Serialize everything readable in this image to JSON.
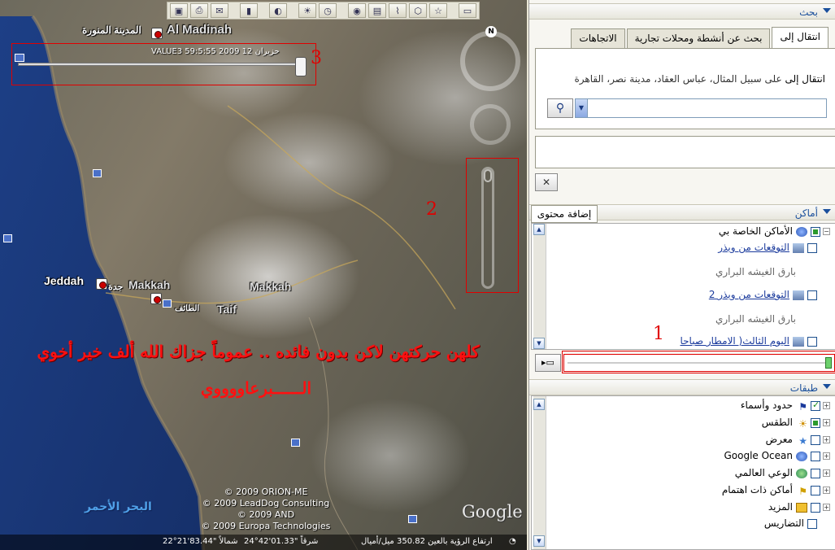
{
  "toolbar": {
    "icons": [
      "sidebar-icon",
      "placemark-icon",
      "polygon-icon",
      "path-icon",
      "image-overlay-icon",
      "record-tour-icon",
      "history-icon",
      "sun-icon",
      "planets-icon",
      "ruler-icon",
      "email-icon",
      "print-icon",
      "google-maps-icon"
    ]
  },
  "map": {
    "cities": {
      "madinah_ar": "المدينة المنورة",
      "madinah_en": "Al Madinah",
      "jeddah_en": "Jeddah",
      "jeddah_ar": "جدة",
      "makkah_en": "Makkah",
      "makkah_ar": "مكة",
      "makkah2": "Makkah",
      "taif_en": "Taif",
      "taif_ar": "الطائف"
    },
    "time_label": "VALUE3 59:5:55 2009 12 حزيران",
    "annotation_numbers": {
      "one": "1",
      "two": "2",
      "three": "3"
    },
    "note_line1": "كلهن حركتهن لاكن بدون فائده .. عموماً جزاك الله ألف خير أخوي",
    "note_line2": "الــــــبرعاووووي",
    "sea_label": "البحر الأحمر",
    "copyright": [
      "© 2009 ORION-ME",
      "© 2009 LeadDog Consulting",
      "© 2009 AND",
      "© 2009 Europa Technologies"
    ],
    "google_logo": "Google",
    "status": {
      "lat": "22°21'83.44\" شمالاً",
      "lon": "24°42'01.33\" شرقاً",
      "alt": "ارتفاع الرؤية بالعين 350.82 ميل/أميال",
      "compass_n": "N"
    }
  },
  "panel": {
    "search_header": "بحث",
    "tabs": [
      "انتقال إلى",
      "بحث عن أنشطة ومحلات تجارية",
      "الاتجاهات"
    ],
    "search_hint_bold": "انتقال إلى",
    "search_hint_rest": "على سبيل المثال، عباس العقاد، مدينة نصر، القاهرة",
    "search_value": "",
    "clear_label": "✕",
    "places_header": "أماكن",
    "add_content": "إضافة محتوى",
    "places_items": [
      {
        "label": "الأماكن الخاصة بي",
        "type": "folder"
      },
      {
        "label": "التوقعات من ويذر",
        "type": "link"
      },
      {
        "label": "بارق الغيشه البراري",
        "type": "plain"
      },
      {
        "label": "التوقعات من ويذر 2",
        "type": "link"
      },
      {
        "label": "بارق الغيشه البراري",
        "type": "plain"
      },
      {
        "label": "اليوم الثالث( الامطار صباحا",
        "type": "link"
      }
    ],
    "layers_header": "طبقات",
    "layers_items": [
      {
        "label": "حدود وأسماء",
        "checked": "on",
        "icon": "flag-icon"
      },
      {
        "label": "الطقس",
        "checked": "mid",
        "icon": "sun-icon"
      },
      {
        "label": "معرض",
        "checked": "off",
        "icon": "star-icon"
      },
      {
        "label": "Google Ocean",
        "checked": "off",
        "icon": "globe-icon"
      },
      {
        "label": "الوعي العالمي",
        "checked": "off",
        "icon": "globe-icon"
      },
      {
        "label": "أماكن ذات اهتمام",
        "checked": "off",
        "icon": "flag-icon"
      },
      {
        "label": "المزيد",
        "checked": "off",
        "icon": "note-icon"
      },
      {
        "label": "التضاريس",
        "checked": "off",
        "icon": ""
      }
    ]
  },
  "colors": {
    "annotation_red": "#e00000",
    "link_blue": "#1a3a9c",
    "header_blue": "#1a4f9c"
  }
}
